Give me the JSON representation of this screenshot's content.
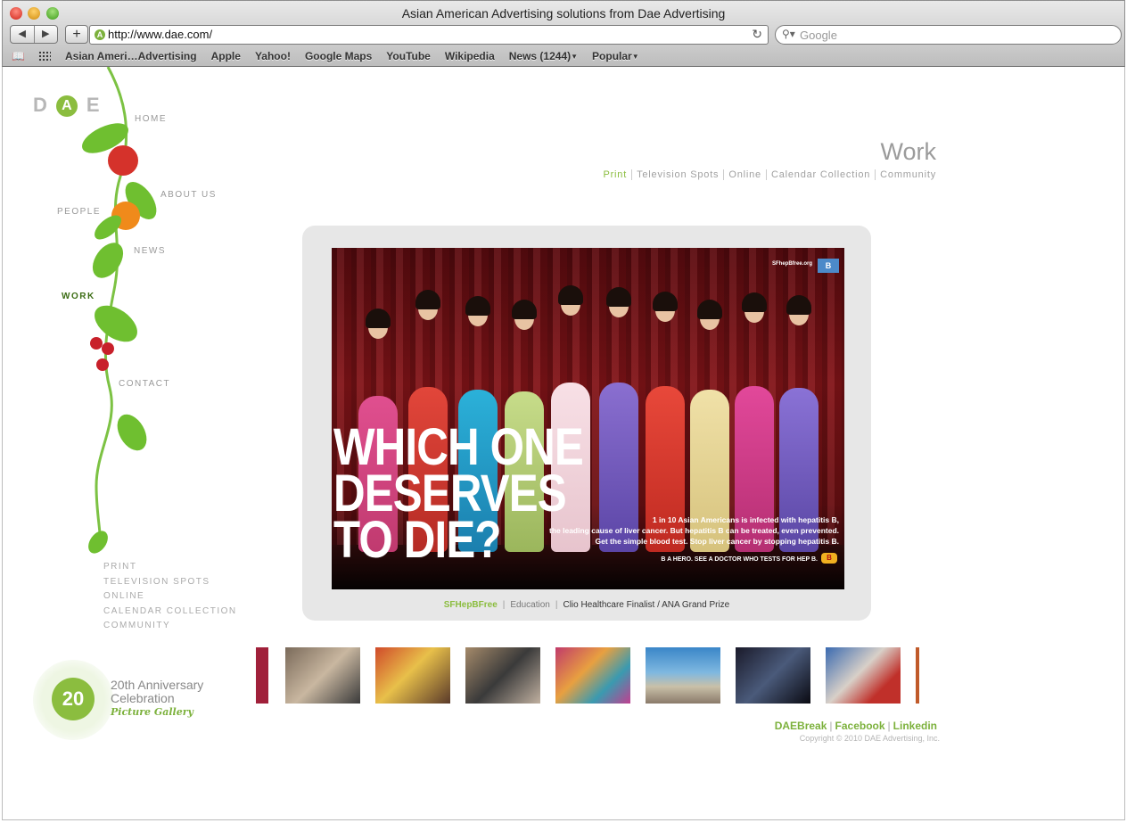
{
  "browser": {
    "window_title": "Asian American Advertising solutions from Dae Advertising",
    "url": "http://www.dae.com/",
    "search_placeholder": "Google",
    "back": "◀",
    "forward": "▶",
    "reload": "↻",
    "bookmarks": [
      {
        "label": "Asian Ameri…Advertising"
      },
      {
        "label": "Apple"
      },
      {
        "label": "Yahoo!"
      },
      {
        "label": "Google Maps"
      },
      {
        "label": "YouTube"
      },
      {
        "label": "Wikipedia"
      },
      {
        "label": "News (1244)",
        "dropdown": true
      },
      {
        "label": "Popular",
        "dropdown": true
      }
    ]
  },
  "site": {
    "logo": {
      "d": "D",
      "a": "A",
      "e": "E"
    },
    "nav": {
      "home": "HOME",
      "about": "ABOUT US",
      "people": "PEOPLE",
      "news": "NEWS",
      "work": "WORK",
      "contact": "CONTACT"
    },
    "sub_nav": [
      "PRINT",
      "TELEVISION SPOTS",
      "ONLINE",
      "CALENDAR COLLECTION",
      "COMMUNITY"
    ],
    "anniversary": {
      "badge": "20",
      "line1": "20th Anniversary",
      "line2": "Celebration",
      "sub": "Picture Gallery"
    },
    "section_title": "Work",
    "work_tabs": [
      "Print",
      "Television Spots",
      "Online",
      "Calendar Collection",
      "Community"
    ],
    "active_tab": "Print",
    "ad": {
      "site": "SFhepBfree.org",
      "logo": "B",
      "headline_1": "WHICH ONE",
      "headline_2": "DESERVES",
      "headline_3": "TO DIE?",
      "body_1": "1 in 10 Asian Americans is infected with hepatitis B,",
      "body_2": "the leading cause of liver cancer. But hepatitis B can be treated, even prevented.",
      "body_3": "Get the simple blood test. Stop liver cancer by stopping hepatitis B.",
      "tagline": "B A HERO. SEE A DOCTOR WHO TESTS FOR HEP B.",
      "badge": "B"
    },
    "caption": {
      "client": "SFHepBFree",
      "category": "Education",
      "award": "Clio Healthcare Finalist / ANA Grand Prize"
    },
    "footer": {
      "links": [
        "DAEBreak",
        "Facebook",
        "Linkedin"
      ],
      "copyright": "Copyright © 2010 DAE Advertising, Inc."
    }
  },
  "colors": {
    "brand_green": "#8bbd3f",
    "active_nav": "#3c6d14",
    "link_green": "#7cb13c"
  }
}
